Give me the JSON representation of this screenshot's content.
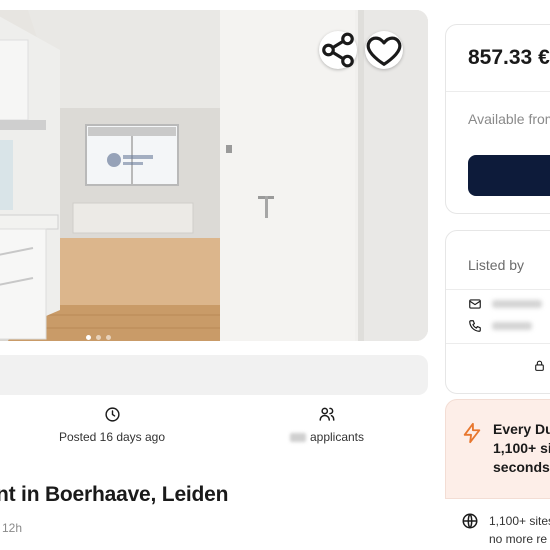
{
  "listing": {
    "title": "nt in Boerhaave, Leiden",
    "subtitle": "12h",
    "posted": "Posted 16 days ago",
    "applicants": "applicants"
  },
  "photo": {
    "carousel_dots": 3,
    "active_dot": 0,
    "share_icon": "share-icon",
    "favorite_icon": "heart-icon"
  },
  "sidebar": {
    "price": "857.33 €",
    "available": "Available from",
    "listed_by": "Listed by",
    "contact_icons": [
      "mail-icon",
      "phone-icon"
    ],
    "lock_icon": "lock-icon"
  },
  "promo": {
    "line1": "Every Du",
    "line2": "1,100+ si",
    "line3": "seconds."
  },
  "feature": {
    "line1": "1,100+ sites",
    "line2": "no more re"
  },
  "colors": {
    "cta": "#0d1b3a",
    "promo_bg": "#fdeee8",
    "promo_icon": "#e8772e"
  }
}
